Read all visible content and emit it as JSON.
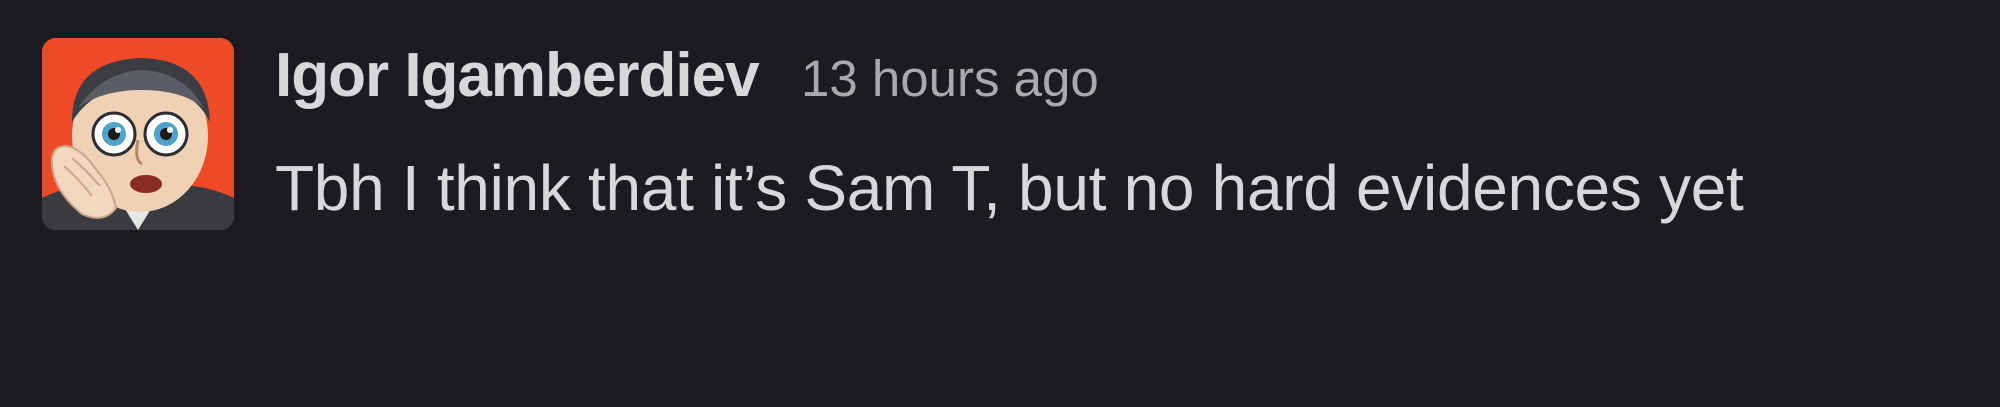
{
  "message": {
    "sender_name": "Igor Igamberdiev",
    "timestamp": "13 hours ago",
    "text": "Tbh I think that it’s Sam T, but no hard evidences yet",
    "avatar": {
      "icon": "cartoon-face-avatar-icon",
      "background_color": "#ef4a27"
    }
  },
  "colors": {
    "background": "#1b1c20",
    "primary_text": "#d7d8da",
    "secondary_text": "#a8a9ad"
  }
}
